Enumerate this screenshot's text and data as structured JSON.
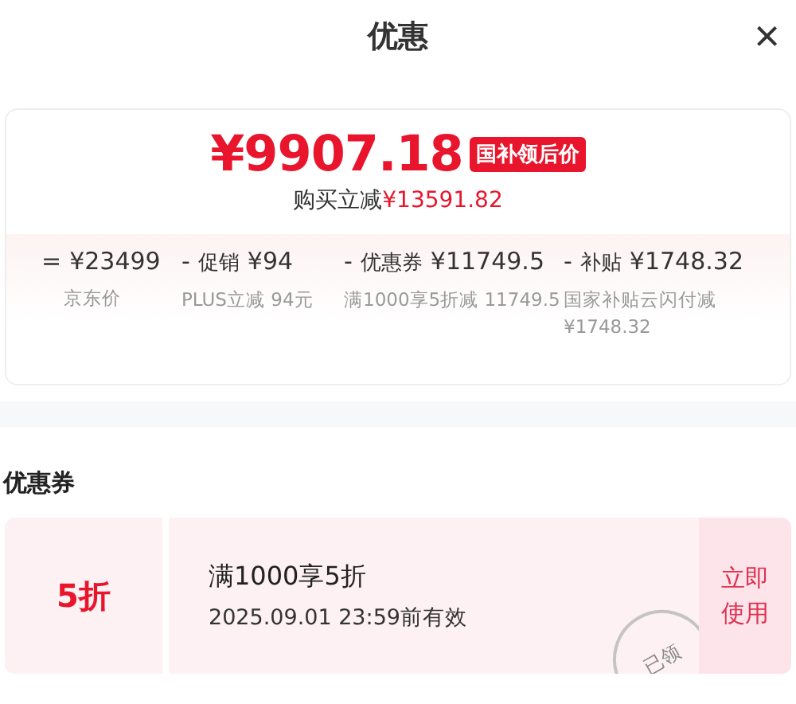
{
  "header": {
    "title": "优惠",
    "close": "×"
  },
  "summary": {
    "price": "¥9907.18",
    "tag": "国补领后价",
    "reduction_label": "购买立减",
    "reduction_amount": "¥13591.82",
    "breakdown": [
      {
        "operator": "=",
        "amount": "¥23499",
        "note": "京东价"
      },
      {
        "operator": "-",
        "label": "促销",
        "amount": "¥94",
        "note": "PLUS立减 94元"
      },
      {
        "operator": "-",
        "label": "优惠券",
        "amount": "¥11749.5",
        "note": "满1000享5折减 11749.5"
      },
      {
        "operator": "-",
        "label": "补贴",
        "amount": "¥1748.32",
        "note": "国家补贴云闪付减 ¥1748.32"
      }
    ]
  },
  "coupons_section": {
    "title": "优惠券",
    "coupons": [
      {
        "value": "5折",
        "title": "满1000享5折",
        "validity": "2025.09.01 23:59前有效",
        "action": "立即使用",
        "stamp": "已领"
      }
    ]
  }
}
